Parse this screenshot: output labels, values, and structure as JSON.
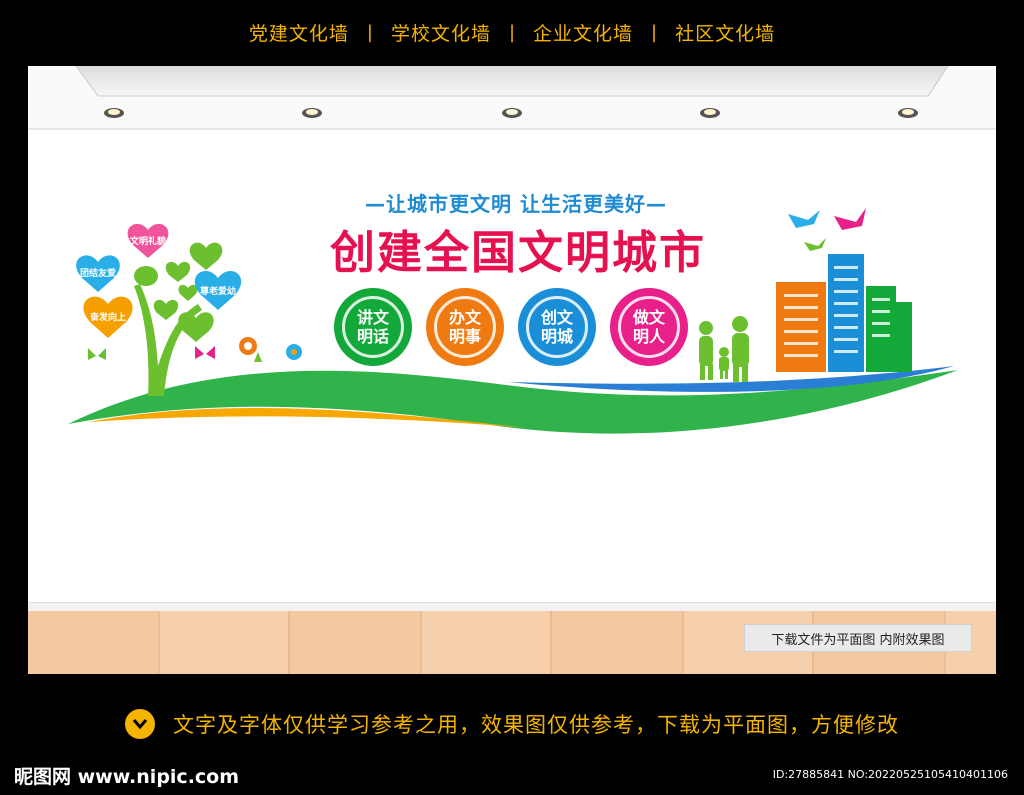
{
  "nav": {
    "items": [
      "党建文化墙",
      "学校文化墙",
      "企业文化墙",
      "社区文化墙"
    ],
    "separator": "|"
  },
  "wall": {
    "slogan": "—让城市更文明  让生活更美好—",
    "title": "创建全国文明城市",
    "badges": [
      {
        "text": "讲文明话",
        "color": "#12a83a"
      },
      {
        "text": "办文明事",
        "color": "#f07a12"
      },
      {
        "text": "创文明城",
        "color": "#1a8fd8"
      },
      {
        "text": "做文明人",
        "color": "#e8208a"
      }
    ],
    "hearts": [
      {
        "text": "文明礼貌",
        "color": "#f0549a"
      },
      {
        "text": "团结友爱",
        "color": "#2aaee8"
      },
      {
        "text": "尊老爱幼",
        "color": "#2aaee8"
      },
      {
        "text": "奋发向上",
        "color": "#f5a000"
      }
    ]
  },
  "notice": "下载文件为平面图  内附效果图",
  "bottom": {
    "text": "文字及字体仅供学习参考之用，效果图仅供参考，下载为平面图，方便修改"
  },
  "footer": {
    "logo": "昵图网 www.nipic.com",
    "image_id": "ID:27885841 NO:20220525105410401106"
  }
}
